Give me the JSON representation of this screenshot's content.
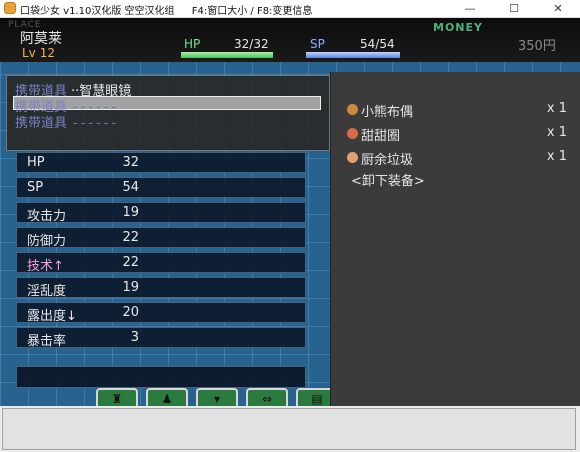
{
  "window": {
    "title": "口袋少女 v1.10汉化版 空空汉化组",
    "hint_f4": "F4:窗口大小 / F8:变更信息",
    "min_label": "—",
    "max_label": "☐",
    "close_label": "✕"
  },
  "header": {
    "place_label": "PLACE",
    "name": "阿莫莱",
    "lv_label": "Lv",
    "lv_value": "12",
    "hp_label": "HP",
    "hp_text": "32/32",
    "hp_ratio": 1.0,
    "sp_label": "SP",
    "sp_text": "54/54",
    "sp_ratio": 1.0,
    "money_label": "MONEY",
    "money_value": "350円"
  },
  "slots": [
    {
      "label": "携带道具",
      "item": "··智慧眼镜"
    },
    {
      "label": "携带道具",
      "item": "------"
    },
    {
      "label": "携带道具",
      "item": "------"
    }
  ],
  "stats": [
    {
      "label": "HP",
      "value": "32"
    },
    {
      "label": "SP",
      "value": "54"
    },
    {
      "label": "攻击力",
      "value": "19"
    },
    {
      "label": "防御力",
      "value": "22"
    },
    {
      "label": "技术↑",
      "value": "22"
    },
    {
      "label": "淫乱度",
      "value": "19"
    },
    {
      "label": "露出度↓",
      "value": "20"
    },
    {
      "label": "暴击率",
      "value": "3"
    }
  ],
  "items": [
    {
      "name": "小熊布偶",
      "qty": "x 1",
      "icon": "teddy-bear-icon",
      "color": "#c98a3e"
    },
    {
      "name": "甜甜圈",
      "qty": "x 1",
      "icon": "donut-icon",
      "color": "#d86a4a"
    },
    {
      "name": "厨余垃圾",
      "qty": "x 1",
      "icon": "trash-bag-icon",
      "color": "#e0a070"
    }
  ],
  "remove_equip": "<卸下装备>",
  "tabs": [
    {
      "icon": "bag-icon",
      "glyph": "♜"
    },
    {
      "icon": "person-icon",
      "glyph": "♟"
    },
    {
      "icon": "underwear-icon",
      "glyph": "▾"
    },
    {
      "icon": "bra-icon",
      "glyph": "⇔"
    },
    {
      "icon": "card-icon",
      "glyph": "▤"
    }
  ]
}
